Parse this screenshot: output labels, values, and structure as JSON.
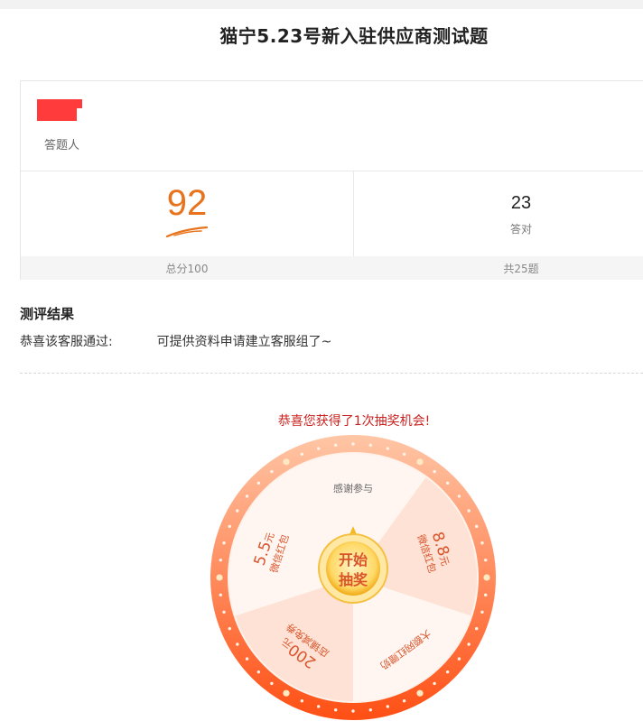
{
  "page": {
    "title": "猫宁5.23号新入驻供应商测试题"
  },
  "respondent": {
    "label": "答题人"
  },
  "stats": {
    "score": "92",
    "total_label": "总分100",
    "correct_count": "23",
    "correct_label": "答对",
    "question_count_label": "共25题"
  },
  "result": {
    "heading": "测评结果",
    "text_prefix": "恭喜该客服通过:",
    "text_suffix": "可提供资料申请建立客服组了~"
  },
  "lottery": {
    "message": "恭喜您获得了1次抽奖机会!",
    "start_line1": "开始",
    "start_line2": "抽奖",
    "prizes": [
      {
        "amount": "",
        "unit": "",
        "desc": "感谢参与"
      },
      {
        "amount": "8.8",
        "unit": "元",
        "desc": "微信红包"
      },
      {
        "amount": "",
        "unit": "",
        "desc": "大额网红赠奶"
      },
      {
        "amount": "200",
        "unit": "元",
        "desc": "店铺减免券"
      },
      {
        "amount": "5.5",
        "unit": "元",
        "desc": "微信红包"
      }
    ],
    "colors": {
      "rim_start": "#ffb48a",
      "rim_end": "#ff5a1f",
      "sector_light": "#fff6f1",
      "sector_dark": "#fde2d5",
      "prize_text": "#d9542b",
      "button_gold": "#f5b820"
    }
  }
}
